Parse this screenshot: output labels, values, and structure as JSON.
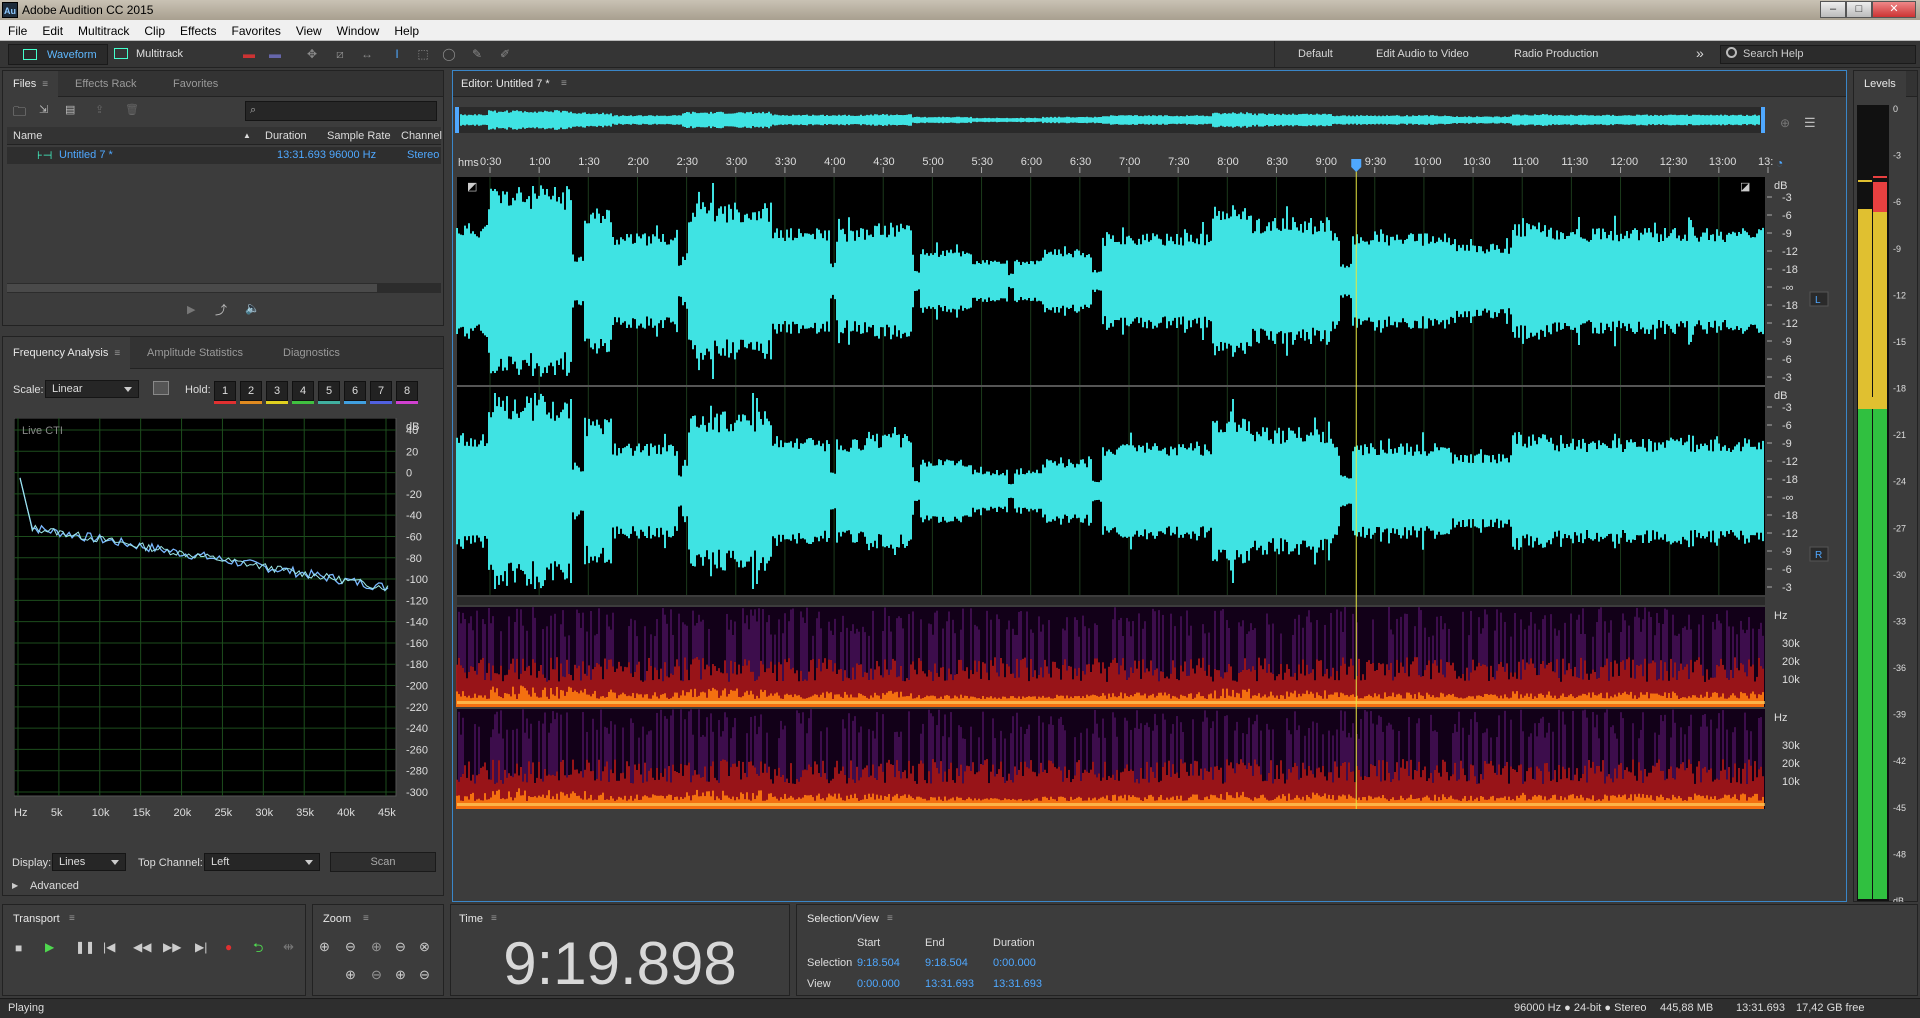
{
  "window": {
    "title": "Adobe Audition CC 2015",
    "logo": "Au",
    "minimize": "–",
    "maximize": "□",
    "close": "✕"
  },
  "menu": [
    "File",
    "Edit",
    "Multitrack",
    "Clip",
    "Effects",
    "Favorites",
    "View",
    "Window",
    "Help"
  ],
  "toolbar": {
    "waveform": "Waveform",
    "multitrack": "Multitrack",
    "workspaces": [
      "Default",
      "Edit Audio to Video",
      "Radio Production"
    ],
    "more": "»",
    "search_placeholder": "Search Help"
  },
  "files_panel": {
    "tabs": [
      "Files",
      "Effects Rack",
      "Favorites"
    ],
    "columns": [
      "Name",
      "Duration",
      "Sample Rate",
      "Channel"
    ],
    "rows": [
      {
        "name": "Untitled 7 *",
        "duration": "13:31.693",
        "sample_rate": "96000 Hz",
        "channel": "Stereo"
      }
    ],
    "search_placeholder": ""
  },
  "analysis_panel": {
    "tabs": [
      "Frequency Analysis",
      "Amplitude Statistics",
      "Diagnostics"
    ],
    "scale_label": "Scale:",
    "scale_value": "Linear",
    "hold_label": "Hold:",
    "hold_buttons": [
      "1",
      "2",
      "3",
      "4",
      "5",
      "6",
      "7",
      "8"
    ],
    "hold_colors": [
      "#e03030",
      "#e08a20",
      "#e0d020",
      "#40c040",
      "#40b0a0",
      "#40a0e0",
      "#5060e0",
      "#d040d0"
    ],
    "graph_label": "Live CTI",
    "y_unit": "dB",
    "y_ticks": [
      "40",
      "20",
      "0",
      "-20",
      "-40",
      "-60",
      "-80",
      "-100",
      "-120",
      "-140",
      "-160",
      "-180",
      "-200",
      "-220",
      "-240",
      "-260",
      "-280",
      "-300"
    ],
    "x_ticks": [
      "Hz",
      "5k",
      "10k",
      "15k",
      "20k",
      "25k",
      "30k",
      "35k",
      "40k",
      "45k"
    ],
    "display_label": "Display:",
    "display_value": "Lines",
    "top_channel_label": "Top Channel:",
    "top_channel_value": "Left",
    "scan_button": "Scan",
    "advanced": "Advanced"
  },
  "editor": {
    "tab": "Editor: Untitled 7 *",
    "ruler_unit": "hms",
    "ruler_ticks": [
      "0:30",
      "1:00",
      "1:30",
      "2:00",
      "2:30",
      "3:00",
      "3:30",
      "4:00",
      "4:30",
      "5:00",
      "5:30",
      "6:00",
      "6:30",
      "7:00",
      "7:30",
      "8:00",
      "8:30",
      "9:00",
      "9:30",
      "10:00",
      "10:30",
      "11:00",
      "11:30",
      "12:00",
      "12:30",
      "13:00",
      "13:"
    ],
    "db_unit": "dB",
    "db_ticks": [
      "-3",
      "-6",
      "-9",
      "-12",
      "-18",
      "-∞",
      "-18",
      "-12",
      "-9",
      "-6",
      "-3"
    ],
    "channel_left": "L",
    "channel_right": "R",
    "hz_unit": "Hz",
    "hz_ticks": [
      "30k",
      "20k",
      "10k"
    ],
    "playhead_time_fraction": 0.6875,
    "wave_color": "#3fe3e3"
  },
  "levels": {
    "title": "Levels",
    "ticks": [
      "0",
      "-3",
      "-6",
      "-9",
      "-12",
      "-15",
      "-18",
      "-21",
      "-24",
      "-27",
      "-30",
      "-33",
      "-36",
      "-39",
      "-42",
      "-45",
      "-48",
      "dB"
    ]
  },
  "transport": {
    "title": "Transport"
  },
  "zoom": {
    "title": "Zoom"
  },
  "time": {
    "title": "Time",
    "value": "9:19.898"
  },
  "selection_view": {
    "title": "Selection/View",
    "headers": [
      "Start",
      "End",
      "Duration"
    ],
    "selection_label": "Selection",
    "selection": [
      "9:18.504",
      "9:18.504",
      "0:00.000"
    ],
    "view_label": "View",
    "view": [
      "0:00.000",
      "13:31.693",
      "13:31.693"
    ]
  },
  "statusbar": {
    "state": "Playing",
    "format": "96000 Hz ● 24-bit ● Stereo",
    "size": "445,88 MB",
    "duration": "13:31.693",
    "free": "17,42 GB free"
  }
}
